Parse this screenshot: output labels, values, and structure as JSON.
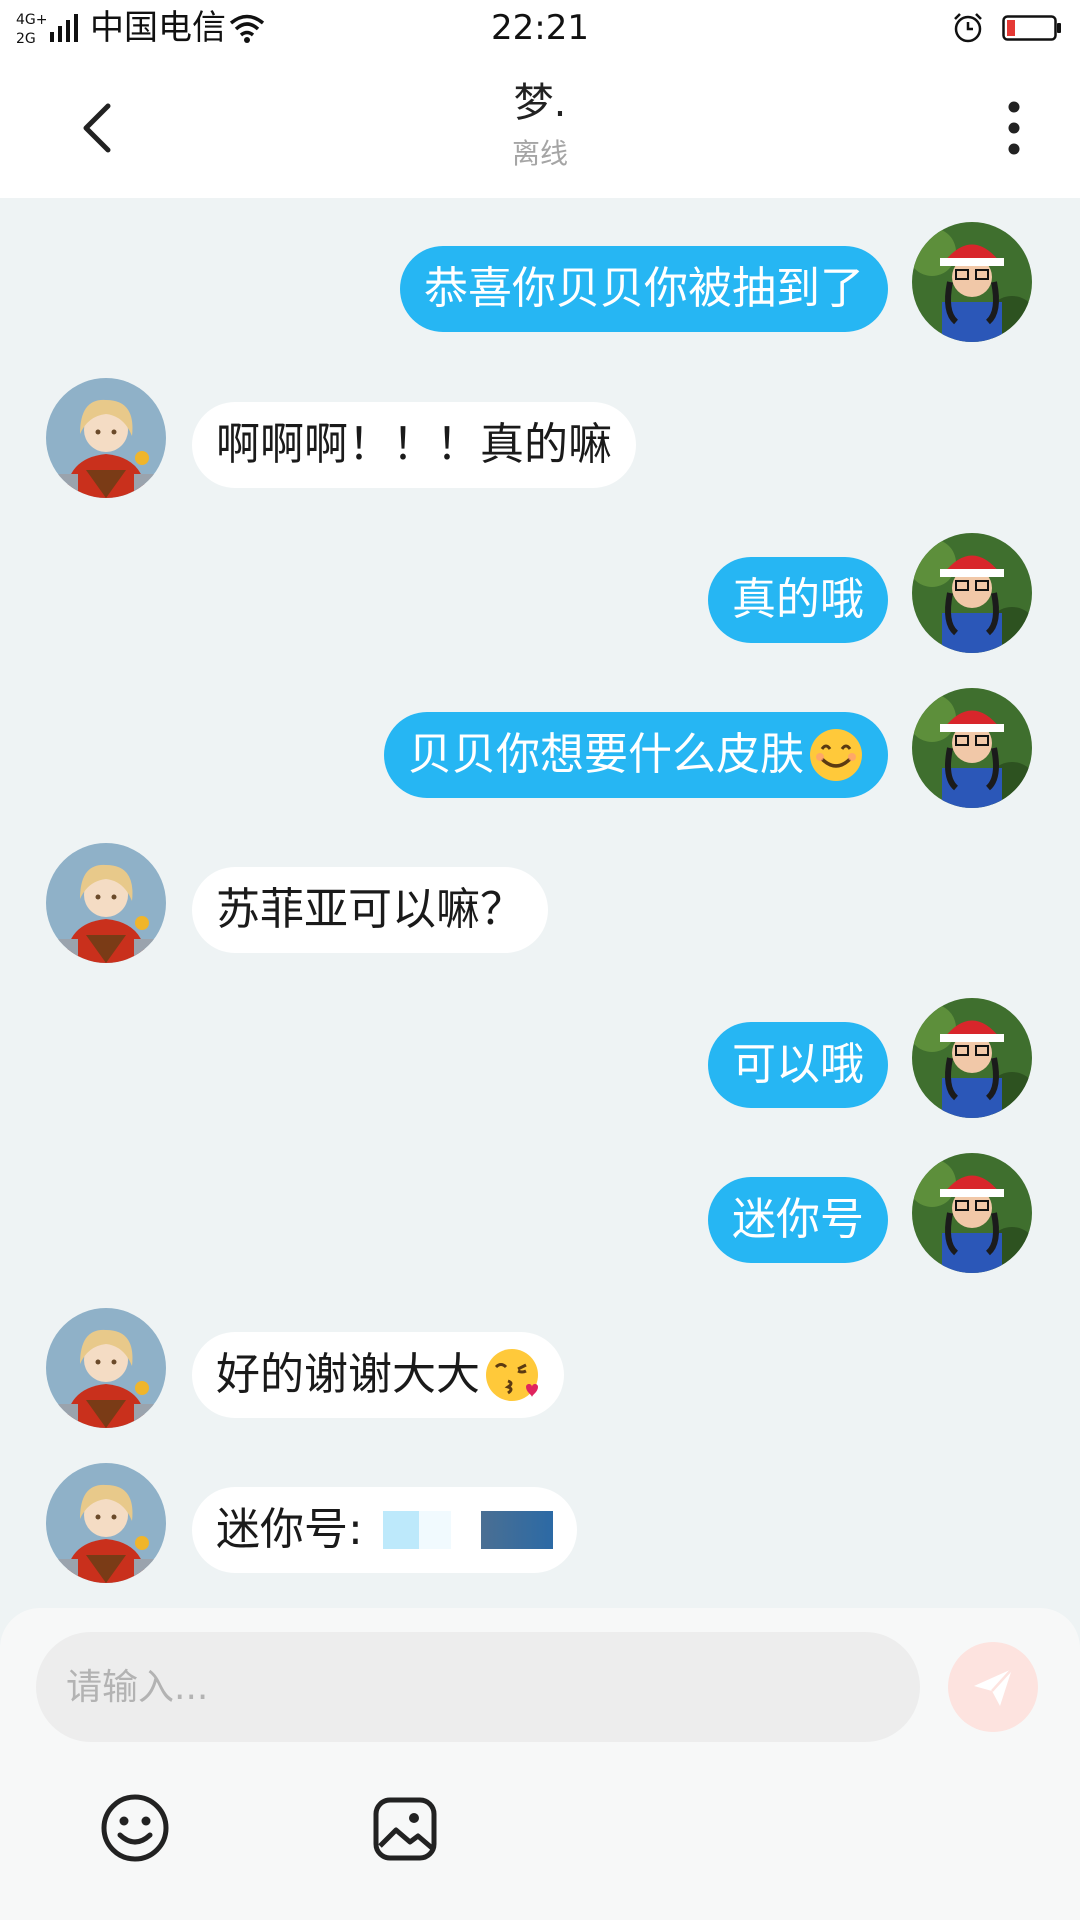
{
  "status_bar": {
    "network": "4G+ 2G",
    "carrier": "中国电信",
    "time": "22:21",
    "battery_color": "#e53935"
  },
  "header": {
    "name": "梦.",
    "status": "离线"
  },
  "colors": {
    "sent_bubble": "#26b6f3",
    "received_bubble": "#ffffff",
    "chat_background": "#eef3f4"
  },
  "messages": [
    {
      "side": "sent",
      "text": "恭喜你贝贝你被抽到了"
    },
    {
      "side": "received",
      "text": "啊啊啊！！！真的嘛"
    },
    {
      "side": "sent",
      "text": "真的哦"
    },
    {
      "side": "sent",
      "text": "贝贝你想要什么皮肤",
      "emoji": "smiling-face-emoji"
    },
    {
      "side": "received",
      "text": "苏菲亚可以嘛？"
    },
    {
      "side": "sent",
      "text": "可以哦"
    },
    {
      "side": "sent",
      "text": "迷你号"
    },
    {
      "side": "received",
      "text": "好的谢谢大大",
      "emoji": "kissing-face-emoji"
    },
    {
      "side": "received",
      "text": "迷你号:",
      "redacted": true
    }
  ],
  "composer": {
    "placeholder": "请输入...",
    "send_icon": "send-icon",
    "emoji_icon": "emoji-icon",
    "image_icon": "image-icon"
  }
}
